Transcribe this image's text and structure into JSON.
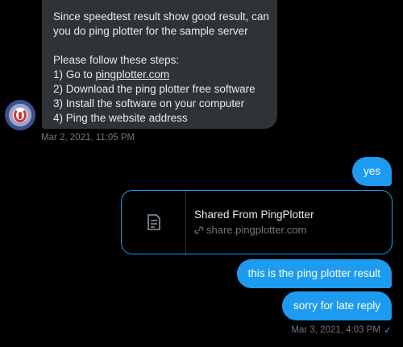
{
  "messages": {
    "incoming": {
      "lines": [
        "Since speedtest result show good result, can",
        "you do ping plotter for the sample server",
        "",
        "Please follow these steps:",
        "1) Go to ",
        "2) Download the ping plotter free software",
        "3) Install the software on your computer",
        "4) Ping the website address"
      ],
      "link_text": "pingplotter.com",
      "timestamp": "Mar 2, 2021, 11:05 PM"
    },
    "outgoing": {
      "yes": "yes",
      "card_title": "Shared From PingPlotter",
      "card_url": "share.pingplotter.com",
      "result": "this is the ping plotter result",
      "sorry": "sorry for late reply",
      "timestamp": "Mar 3, 2021, 4:03 PM"
    }
  },
  "icons": {
    "avatar": "avatar-icon",
    "card_thumb": "document-icon",
    "card_link": "link-icon",
    "read_receipt": "check-icon"
  },
  "colors": {
    "accent": "#1d9bf0",
    "incoming_bubble": "#2f3336",
    "muted_text": "#71767b",
    "background": "#000000"
  }
}
